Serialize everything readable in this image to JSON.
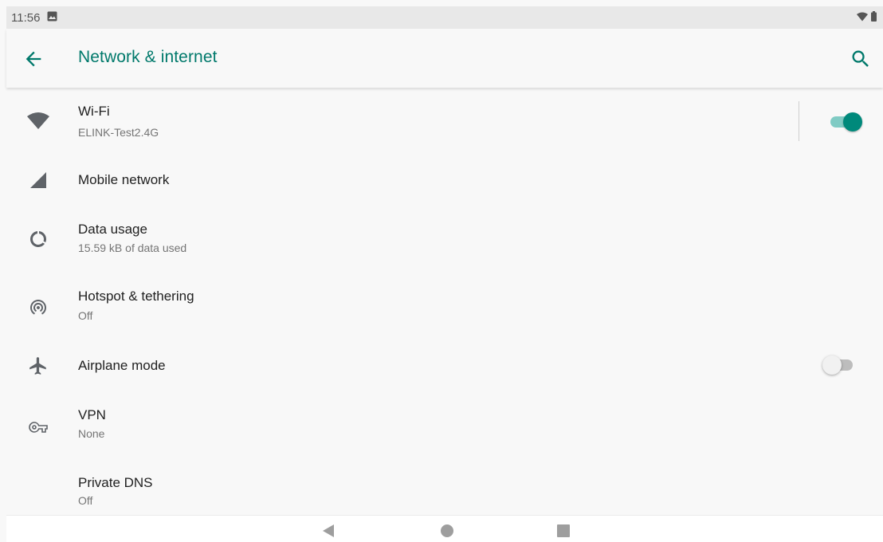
{
  "status_bar": {
    "time": "11:56",
    "icons": [
      "gallery-notification-icon",
      "wifi-status-icon",
      "battery-icon"
    ]
  },
  "header": {
    "title": "Network & internet",
    "back_icon": "arrow-back-icon",
    "search_icon": "search-icon"
  },
  "colors": {
    "accent": "#00796b",
    "toggle_on_thumb": "#00897b",
    "toggle_on_track": "#80cbc4",
    "icon_gray": "#5f6368"
  },
  "settings": {
    "wifi": {
      "label": "Wi-Fi",
      "summary": "ELINK-Test2.4G",
      "icon": "wifi-icon",
      "toggle": "on"
    },
    "mobile": {
      "label": "Mobile network",
      "icon": "signal-icon"
    },
    "data_usage": {
      "label": "Data usage",
      "summary": "15.59 kB of data used",
      "icon": "data-usage-icon"
    },
    "hotspot": {
      "label": "Hotspot & tethering",
      "summary": "Off",
      "icon": "hotspot-icon"
    },
    "airplane": {
      "label": "Airplane mode",
      "icon": "airplane-icon",
      "toggle": "off"
    },
    "vpn": {
      "label": "VPN",
      "summary": "None",
      "icon": "vpn-key-icon"
    },
    "private_dns": {
      "label": "Private DNS",
      "summary": "Off"
    }
  },
  "nav_bar": {
    "buttons": [
      "back-nav-icon",
      "home-nav-icon",
      "recents-nav-icon"
    ]
  }
}
